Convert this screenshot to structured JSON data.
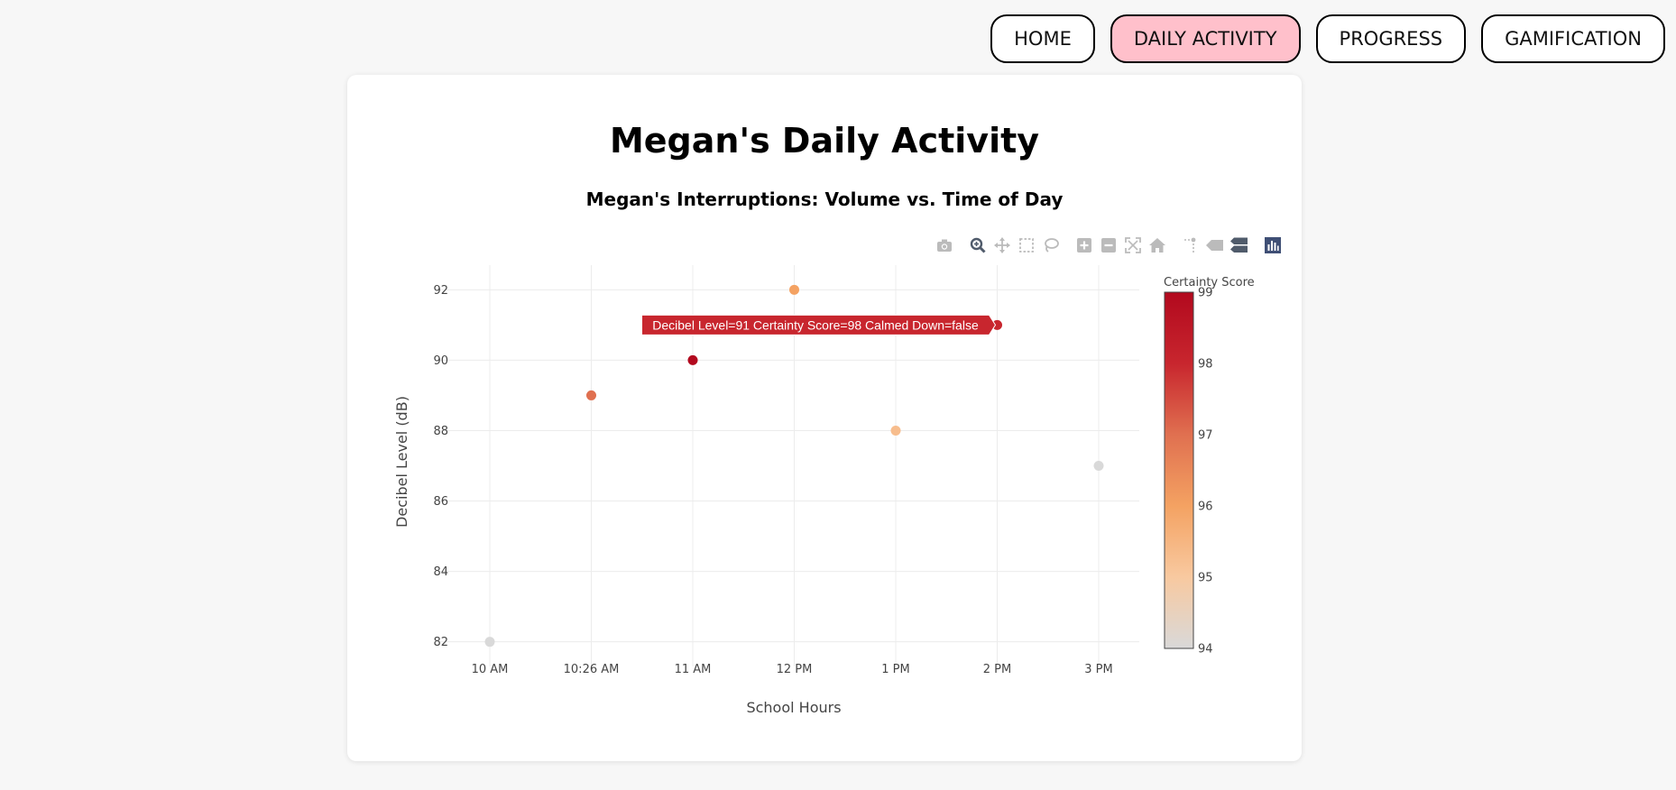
{
  "nav": {
    "items": [
      {
        "label": "HOME",
        "active": false
      },
      {
        "label": "DAILY ACTIVITY",
        "active": true
      },
      {
        "label": "PROGRESS",
        "active": false
      },
      {
        "label": "GAMIFICATION",
        "active": false
      }
    ],
    "active_color": "#ffc0cb"
  },
  "page": {
    "title": "Megan's Daily Activity"
  },
  "modebar": {
    "icons": [
      "camera-icon",
      "zoom-icon",
      "pan-icon",
      "box-select-icon",
      "lasso-select-icon",
      "zoom-in-icon",
      "zoom-out-icon",
      "autoscale-icon",
      "reset-axes-icon",
      "spike-lines-icon",
      "hover-closest-icon",
      "hover-compare-icon",
      "plotly-logo-icon"
    ]
  },
  "tooltip": {
    "text": "Decibel Level=91 Certainty Score=98 Calmed Down=false",
    "color": "#c8262e"
  },
  "chart_data": {
    "type": "scatter",
    "title": "Megan's Interruptions: Volume vs. Time of Day",
    "xlabel": "School Hours",
    "ylabel": "Decibel Level (dB)",
    "x_ticks": [
      "10 AM",
      "10:26 AM",
      "11 AM",
      "12 PM",
      "1 PM",
      "2 PM",
      "3 PM"
    ],
    "y_ticks": [
      82,
      84,
      86,
      88,
      90,
      92
    ],
    "ylim": [
      81.3,
      92.7
    ],
    "points": [
      {
        "x": "10 AM",
        "y": 82,
        "certainty": 94
      },
      {
        "x": "10:26 AM",
        "y": 89,
        "certainty": 97
      },
      {
        "x": "11 AM",
        "y": 90,
        "certainty": 99
      },
      {
        "x": "12 PM",
        "y": 92,
        "certainty": 96
      },
      {
        "x": "1 PM",
        "y": 88,
        "certainty": 95.3
      },
      {
        "x": "2 PM",
        "y": 91,
        "certainty": 98
      },
      {
        "x": "3 PM",
        "y": 87,
        "certainty": 94
      }
    ],
    "colorbar": {
      "title": "Certainty Score",
      "min": 94,
      "max": 99,
      "ticks": [
        94,
        95,
        96,
        97,
        98,
        99
      ],
      "colorscale": [
        "#d9d9d9",
        "#f8c9a0",
        "#f4a262",
        "#e07050",
        "#c8262e",
        "#b2091e"
      ]
    },
    "grid": true
  }
}
